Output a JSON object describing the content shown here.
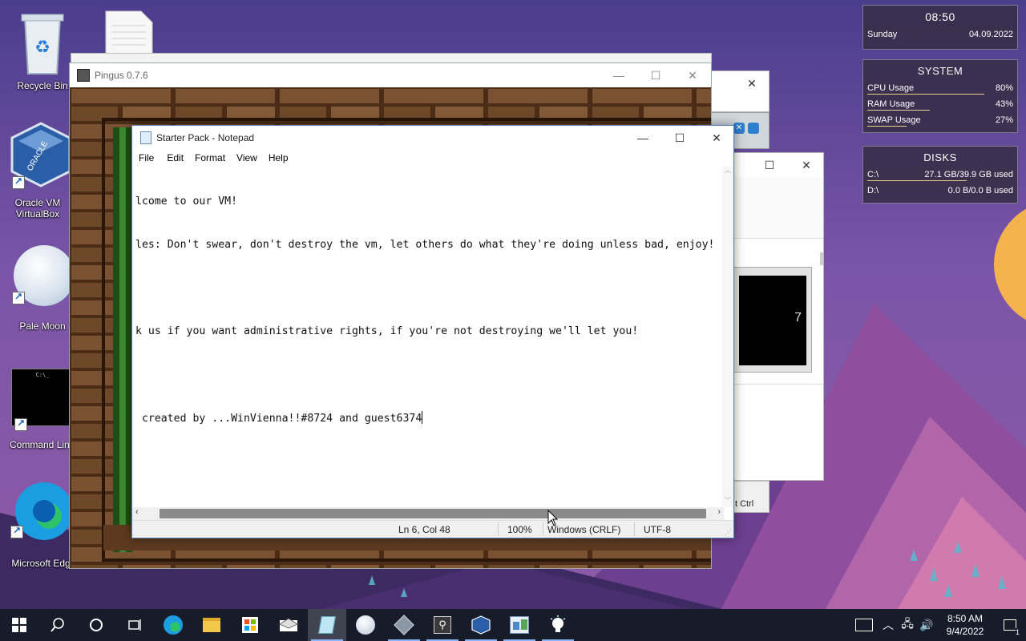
{
  "desktop": {
    "icons": [
      {
        "label": "Recycle Bin",
        "icon": "recycle-bin-icon"
      },
      {
        "label": "Oracle VM\nVirtualBox",
        "icon": "virtualbox-icon"
      },
      {
        "label": "Pale Moon",
        "icon": "pale-moon-icon"
      },
      {
        "label": "Command Lin",
        "icon": "command-line-icon"
      },
      {
        "label": "Microsoft Edg",
        "icon": "edge-icon"
      }
    ]
  },
  "widgets": {
    "clock": {
      "time": "08:50",
      "day": "Sunday",
      "date": "04.09.2022"
    },
    "system": {
      "title": "SYSTEM",
      "rows": [
        {
          "label": "CPU Usage",
          "value": "80%",
          "level": 0.8
        },
        {
          "label": "RAM Usage",
          "value": "43%",
          "level": 0.43
        },
        {
          "label": "SWAP Usage",
          "value": "27%",
          "level": 0.27
        }
      ]
    },
    "disks": {
      "title": "DISKS",
      "rows": [
        {
          "label": "C:\\",
          "value": "27.1 GB/39.9 GB used",
          "level": 0.68
        },
        {
          "label": "D:\\",
          "value": "0.0 B/0.0 B used",
          "level": 0.0
        }
      ]
    }
  },
  "pingus": {
    "title": "Pingus 0.7.6"
  },
  "background_window": {
    "label": "t Ctrl",
    "number": "7"
  },
  "notepad": {
    "title": "Starter Pack - Notepad",
    "menu": [
      "File",
      "Edit",
      "Format",
      "View",
      "Help"
    ],
    "lines": [
      "lcome to our VM!",
      "les: Don't swear, don't destroy the vm, let others do what they're doing unless bad, enjoy!",
      "",
      "k us if you want administrative rights, if you're not destroying we'll let you!",
      "",
      " created by ...WinVienna!!#8724 and guest6374"
    ],
    "status": {
      "position": "Ln 6, Col 48",
      "zoom": "100%",
      "line_ending": "Windows (CRLF)",
      "encoding": "UTF-8"
    }
  },
  "taskbar": {
    "buttons": [
      {
        "icon": "start-windows-icon",
        "running": false,
        "active": false
      },
      {
        "icon": "search-icon",
        "running": false,
        "active": false
      },
      {
        "icon": "cortana-circle-icon",
        "running": false,
        "active": false
      },
      {
        "icon": "task-view-icon",
        "running": false,
        "active": false
      },
      {
        "icon": "edge-icon",
        "running": false,
        "active": false
      },
      {
        "icon": "file-explorer-icon",
        "running": false,
        "active": false
      },
      {
        "icon": "store-icon",
        "running": false,
        "active": false
      },
      {
        "icon": "mail-icon",
        "running": false,
        "active": false
      },
      {
        "icon": "notepad-icon",
        "running": true,
        "active": true
      },
      {
        "icon": "pale-moon-icon",
        "running": false,
        "active": false
      },
      {
        "icon": "app-compass-icon",
        "running": true,
        "active": false
      },
      {
        "icon": "pingus-icon",
        "running": true,
        "active": false
      },
      {
        "icon": "virtualbox-icon",
        "running": true,
        "active": false
      },
      {
        "icon": "control-panel-icon",
        "running": true,
        "active": false
      },
      {
        "icon": "tips-bulb-icon",
        "running": true,
        "active": false
      }
    ],
    "tray": {
      "time": "8:50 AM",
      "date": "9/4/2022",
      "notifications": "1"
    }
  }
}
